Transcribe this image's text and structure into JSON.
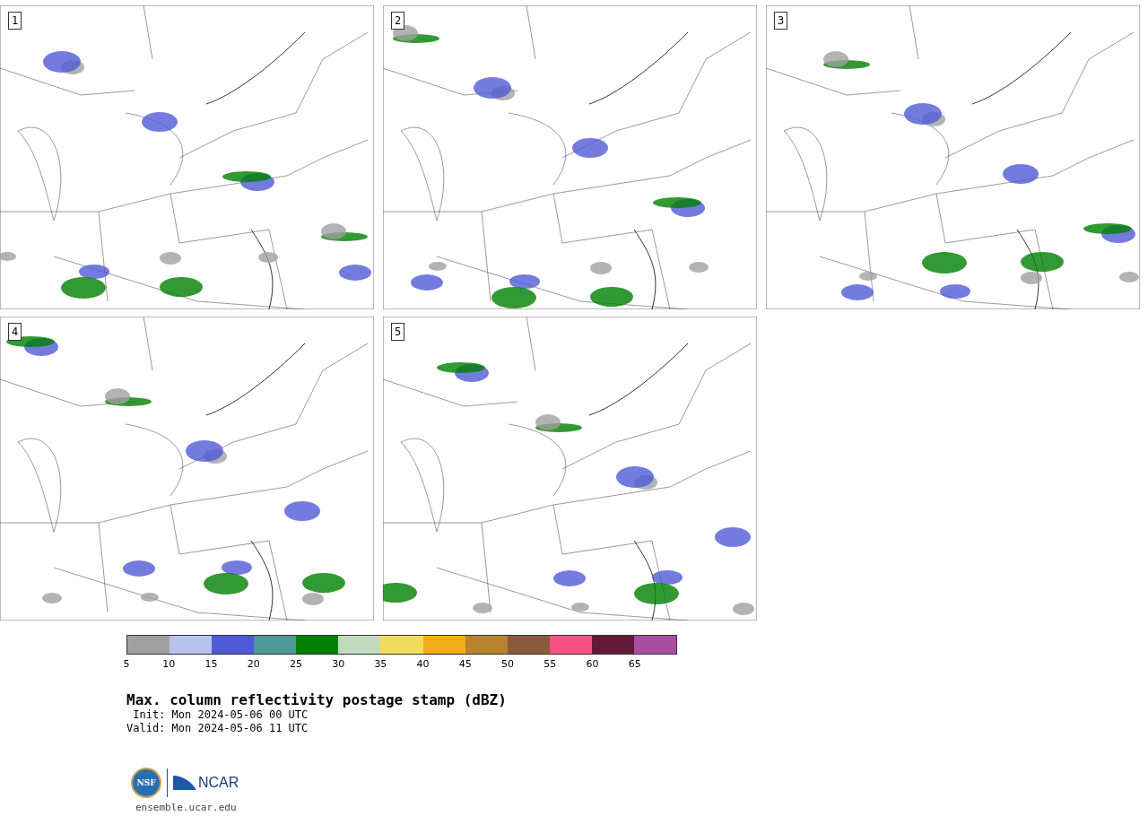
{
  "panels": [
    {
      "label": "1"
    },
    {
      "label": "2"
    },
    {
      "label": "3"
    },
    {
      "label": "4"
    },
    {
      "label": "5"
    }
  ],
  "colorbar": {
    "bins": [
      {
        "color": "#a0a0a0"
      },
      {
        "color": "#b8c2ec"
      },
      {
        "color": "#505ad6"
      },
      {
        "color": "#4e9898"
      },
      {
        "color": "#008000"
      },
      {
        "color": "#c0dcbc"
      },
      {
        "color": "#f0dc5a"
      },
      {
        "color": "#f0ae14"
      },
      {
        "color": "#b88230"
      },
      {
        "color": "#8a5a3c"
      },
      {
        "color": "#f55282"
      },
      {
        "color": "#641838"
      },
      {
        "color": "#aa4ca2"
      }
    ],
    "ticks": [
      "5",
      "10",
      "15",
      "20",
      "25",
      "30",
      "35",
      "40",
      "45",
      "50",
      "55",
      "60",
      "65"
    ]
  },
  "title": "Max. column reflectivity postage stamp (dBZ)",
  "init": " Init: Mon 2024-05-06 00 UTC",
  "valid": "Valid: Mon 2024-05-06 11 UTC",
  "logo": {
    "left": "NSF",
    "right": "NCAR"
  },
  "footer_url": "ensemble.ucar.edu"
}
